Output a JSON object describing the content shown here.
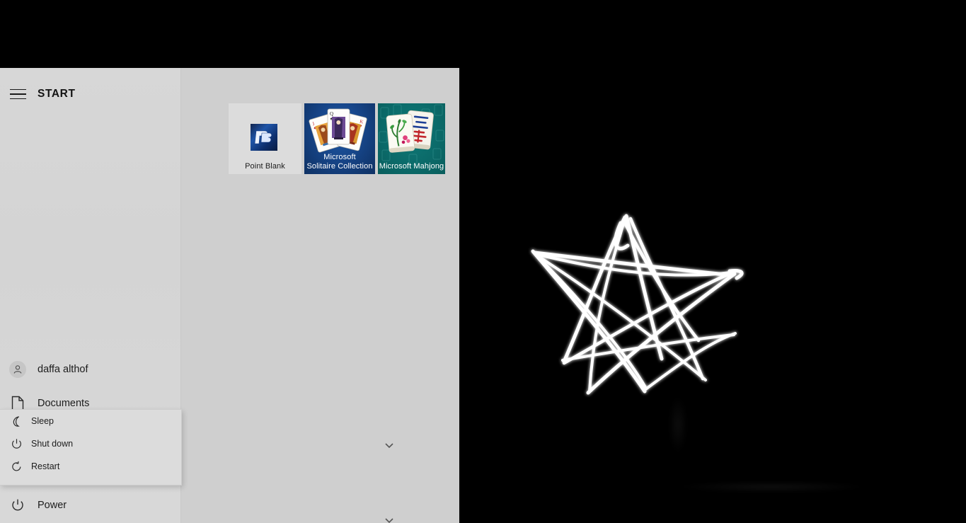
{
  "desktop": {
    "background_color": "#000000",
    "doodle": {
      "name": "hand-drawn-star-doodle",
      "stroke_color": "#ffffff",
      "description": "hand-drawn white star scribble"
    }
  },
  "start_menu": {
    "title": "START",
    "hamburger_icon": "hamburger-menu-icon",
    "background_color": "#d2d2d2",
    "nav_items": [
      {
        "label": "daffa althof",
        "icon": "user-avatar-icon"
      },
      {
        "label": "Documents",
        "icon": "document-icon"
      },
      {
        "label": "Power",
        "icon": "power-icon"
      }
    ],
    "power_flyout": {
      "visible": true,
      "items": [
        {
          "label": "Sleep",
          "icon": "moon-icon"
        },
        {
          "label": "Shut down",
          "icon": "power-icon"
        },
        {
          "label": "Restart",
          "icon": "restart-icon"
        }
      ]
    },
    "group_chevrons": [
      {
        "icon": "chevron-down-icon"
      },
      {
        "icon": "chevron-down-icon"
      }
    ],
    "tiles": [
      {
        "label": "Point Blank",
        "icon": "point-blank-app-icon",
        "tile_color": "#dcdcdc",
        "label_color": "#1c1c1c"
      },
      {
        "label": "Microsoft\nSolitaire Collection",
        "label_line1": "Microsoft",
        "label_line2": "Solitaire Collection",
        "icon": "playing-cards-icon",
        "tile_color": "#17468a",
        "label_color": "#ffffff"
      },
      {
        "label": "Microsoft Mahjong",
        "icon": "mahjong-tiles-icon",
        "tile_color": "#0b6b6a",
        "label_color": "#ffffff"
      }
    ]
  }
}
